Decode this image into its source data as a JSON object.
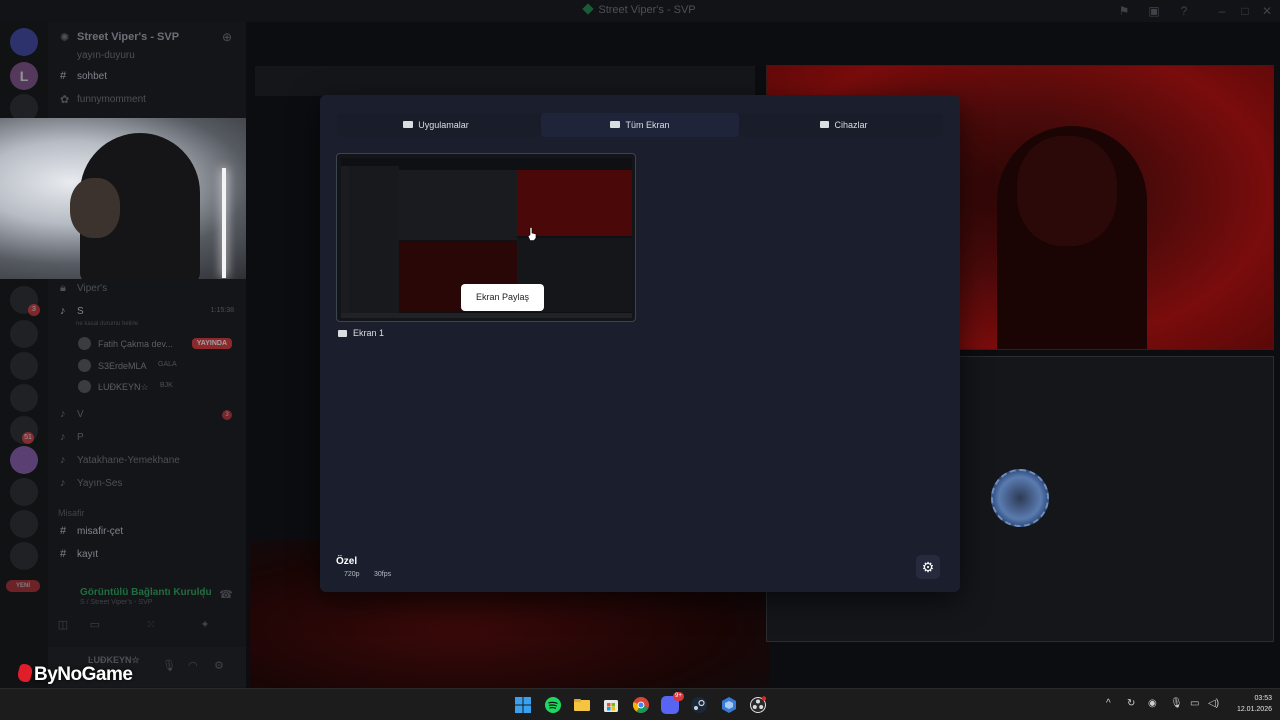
{
  "window": {
    "title": "Street Viper's - SVP"
  },
  "server": {
    "name": "Street Viper's - SVP",
    "channels": [
      {
        "type": "text",
        "label": "yayın-duyuru"
      },
      {
        "type": "text",
        "label": "sohbet"
      },
      {
        "type": "text",
        "label": "funnymomment"
      },
      {
        "type": "text",
        "label": "Viper's"
      },
      {
        "type": "voice",
        "label": "S",
        "time": "1:15:38",
        "status": "ne kasal durumu belirle"
      },
      {
        "type": "voice",
        "label": "V",
        "badge": "3"
      },
      {
        "type": "voice",
        "label": "P"
      },
      {
        "type": "voice",
        "label": "Yatakhane-Yemekhane"
      },
      {
        "type": "voice",
        "label": "Yayın-Ses"
      },
      {
        "type": "text",
        "label": "misafir-çet"
      },
      {
        "type": "text",
        "label": "kayıt"
      }
    ],
    "voice_users": [
      {
        "name": "Fatih Çakma dev...",
        "live": "YAYINDA"
      },
      {
        "name": "S3ErdeMLA",
        "tag": "GALA"
      },
      {
        "name": "ĿUĐKEYN☆",
        "tag": "BJK"
      }
    ],
    "category": "Misafir",
    "new_badge": "YENİ"
  },
  "voice_panel": {
    "status": "Görüntülü Bağlantı Kuruldu",
    "subtitle": "S / Street Viper's - SVP"
  },
  "userbar": {
    "username": "ĿUĐKEYN☆"
  },
  "modal": {
    "tabs": [
      {
        "label": "Uygulamalar",
        "icon": "window-icon"
      },
      {
        "label": "Tüm Ekran",
        "icon": "monitor-icon",
        "active": true
      },
      {
        "label": "Cihazlar",
        "icon": "camera-icon"
      }
    ],
    "source": {
      "label": "Ekran 1",
      "share_button": "Ekran Paylaş"
    },
    "quality": {
      "title": "Özel",
      "resolution": "720p",
      "fps": "30fps"
    }
  },
  "watermark": "ByNoGame",
  "taskbar": {
    "clock_time": "03:53",
    "clock_date": "12.01.2026",
    "discord_badge": "9+"
  },
  "colors": {
    "accent": "#5865f2",
    "live": "#da373c",
    "modal_bg": "#1b1e2d",
    "online": "#23a55a"
  }
}
